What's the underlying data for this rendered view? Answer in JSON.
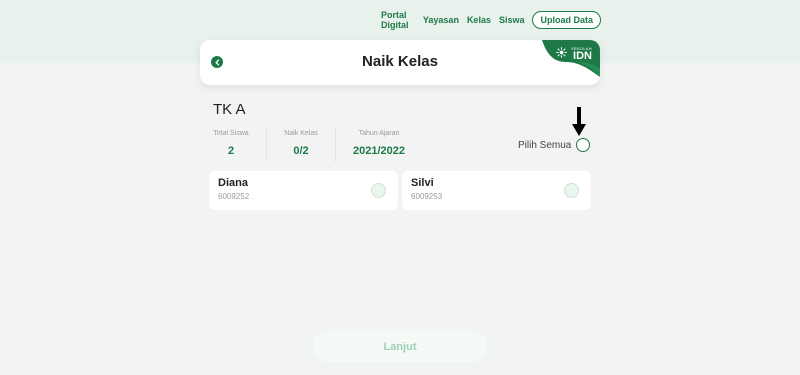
{
  "nav": {
    "links": [
      "Portal Digital",
      "Yayasan",
      "Kelas",
      "Siswa"
    ],
    "upload_label": "Upload Data"
  },
  "header": {
    "title": "Naik Kelas",
    "logo_small": "SEKOLAH",
    "logo_big": "IDN"
  },
  "class": {
    "name": "TK A",
    "stats": [
      {
        "label": "Total Siswa",
        "value": "2"
      },
      {
        "label": "Naik Kelas",
        "value": "0/2"
      },
      {
        "label": "Tahun Ajaran",
        "value": "2021/2022"
      }
    ],
    "select_all_label": "Pilih Semua"
  },
  "students": [
    {
      "name": "Diana",
      "id": "6009252",
      "selected": false
    },
    {
      "name": "Silvi",
      "id": "6009253",
      "selected": false
    }
  ],
  "footer": {
    "continue_label": "Lanjut"
  },
  "colors": {
    "accent": "#1d7a47",
    "background": "#f2f4f3",
    "top_band": "#e8f1ec"
  }
}
